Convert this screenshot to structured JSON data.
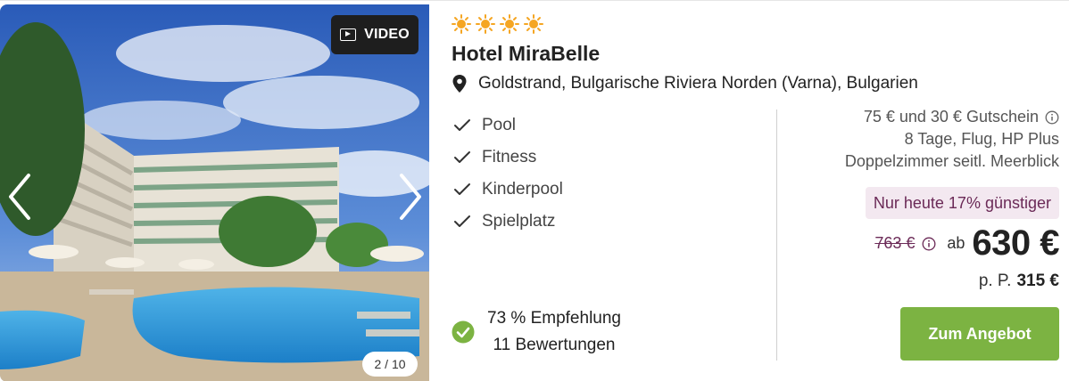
{
  "media": {
    "video_label": "VIDEO",
    "pager": "2 / 10"
  },
  "hotel": {
    "stars": 4,
    "name": "Hotel MiraBelle",
    "location": "Goldstrand, Bulgarische Riviera Norden (Varna), Bulgarien"
  },
  "amenities": [
    "Pool",
    "Fitness",
    "Kinderpool",
    "Spielplatz"
  ],
  "rating": {
    "recommendation": "73 % Empfehlung",
    "reviews": "11 Bewertungen"
  },
  "offer": {
    "voucher": "75 € und 30 € Gutschein",
    "duration": "8 Tage, Flug, HP Plus",
    "room": "Doppelzimmer seitl. Meerblick",
    "deal_badge": "Nur heute 17% günstiger",
    "old_price": "763 €",
    "ab_label": "ab",
    "price": "630 €",
    "pp_label": "p. P.",
    "pp_price": "315 €",
    "cta_label": "Zum Angebot"
  },
  "colors": {
    "star": "#f5a623",
    "cta": "#7cb342",
    "badge_bg": "#f3e8f0",
    "badge_text": "#6b2a57",
    "ok": "#7cb342"
  },
  "icons": [
    "sun-star-icon",
    "map-pin-icon",
    "check-icon",
    "check-circle-icon",
    "info-icon",
    "video-icon",
    "chevron-left-icon",
    "chevron-right-icon"
  ]
}
